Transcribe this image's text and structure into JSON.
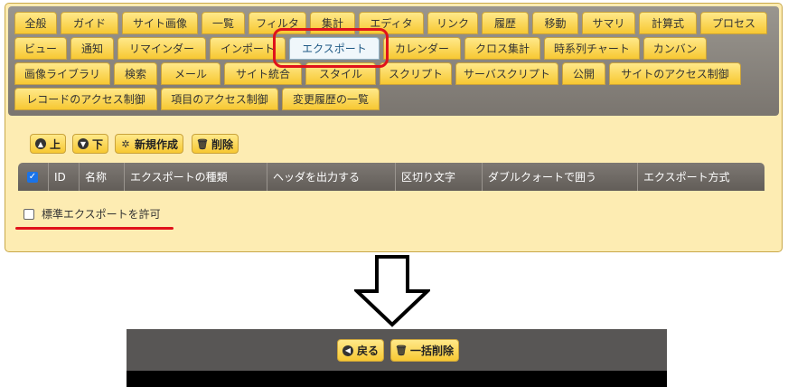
{
  "tabs": {
    "row1": [
      "全般",
      "ガイド",
      "サイト画像",
      "一覧",
      "フィルタ",
      "集計",
      "エディタ",
      "リンク",
      "履歴",
      "移動",
      "サマリ",
      "計算式",
      "プロセス"
    ],
    "row2": [
      "ビュー",
      "通知",
      "リマインダー",
      "インポート",
      "エクスポート",
      "カレンダー",
      "クロス集計",
      "時系列チャート",
      "カンバン"
    ],
    "row3": [
      "画像ライブラリ",
      "検索",
      "メール",
      "サイト統合",
      "スタイル",
      "スクリプト",
      "サーバスクリプト",
      "公開",
      "サイトのアクセス制御"
    ],
    "row4": [
      "レコードのアクセス制御",
      "項目のアクセス制御",
      "変更履歴の一覧"
    ],
    "active": "エクスポート"
  },
  "toolbar": {
    "up_label": "上",
    "down_label": "下",
    "new_label": "新規作成",
    "delete_label": "削除"
  },
  "grid": {
    "columns": [
      "ID",
      "名称",
      "エクスポートの種類",
      "ヘッダを出力する",
      "区切り文字",
      "ダブルクォートで囲う",
      "エクスポート方式"
    ],
    "select_all_checked": true
  },
  "options": {
    "allow_standard_export_label": "標準エクスポートを許可",
    "allow_standard_export_checked": false
  },
  "footer": {
    "back_label": "戻る",
    "bulk_delete_label": "一括削除"
  },
  "colors": {
    "tab_bg": "#f7c832",
    "panel_bg": "#fdecb2",
    "highlight": "#e0121b",
    "active_tab_text": "#1f5a86"
  }
}
